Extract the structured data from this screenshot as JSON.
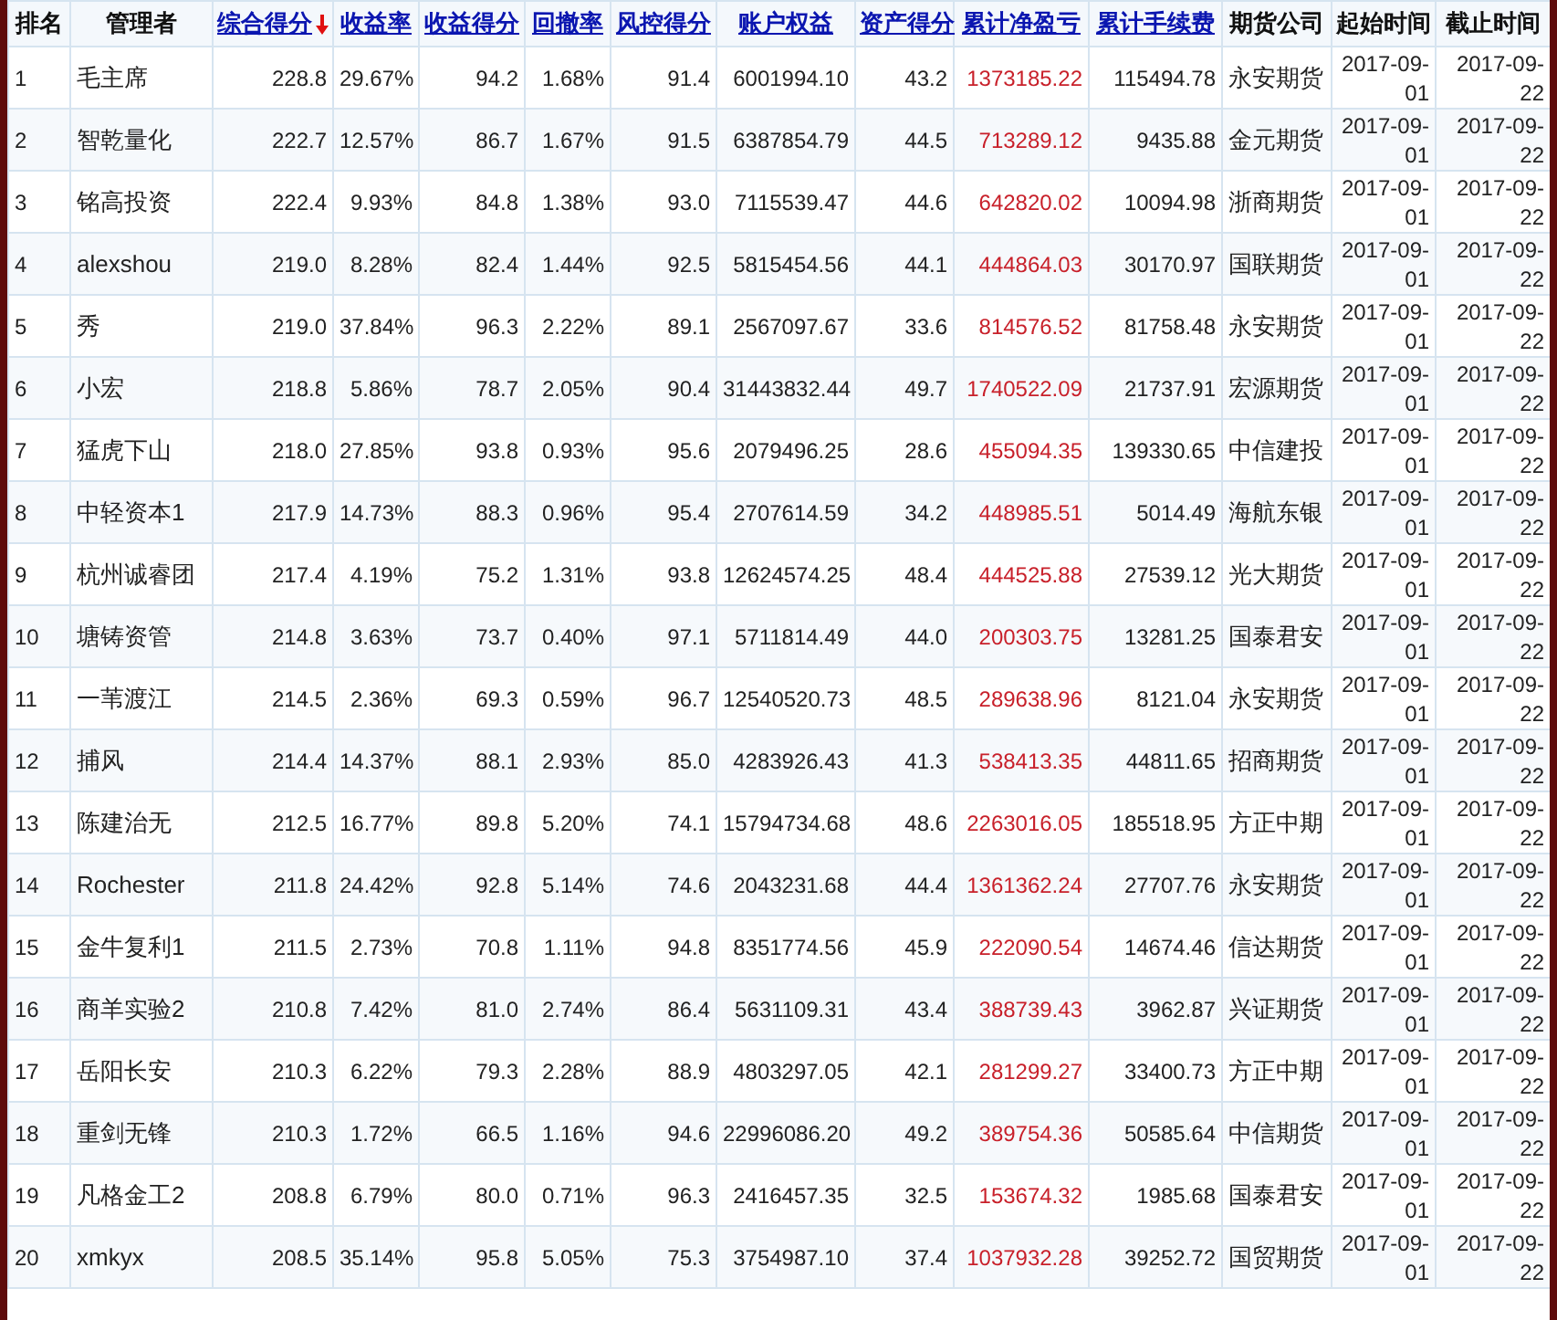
{
  "table": {
    "columns": [
      {
        "label": "排名",
        "link": false,
        "sorted": false
      },
      {
        "label": "管理者",
        "link": false,
        "sorted": false
      },
      {
        "label": "综合得分",
        "link": true,
        "sorted": true
      },
      {
        "label": "收益率",
        "link": true,
        "sorted": false
      },
      {
        "label": "收益得分",
        "link": true,
        "sorted": false
      },
      {
        "label": "回撤率",
        "link": true,
        "sorted": false
      },
      {
        "label": "风控得分",
        "link": true,
        "sorted": false
      },
      {
        "label": "账户权益",
        "link": true,
        "sorted": false
      },
      {
        "label": "资产得分",
        "link": true,
        "sorted": false
      },
      {
        "label": "累计净盈亏",
        "link": true,
        "sorted": false
      },
      {
        "label": "累计手续费",
        "link": true,
        "sorted": false
      },
      {
        "label": "期货公司",
        "link": false,
        "sorted": false
      },
      {
        "label": "起始时间",
        "link": false,
        "sorted": false
      },
      {
        "label": "截止时间",
        "link": false,
        "sorted": false
      }
    ],
    "rows": [
      {
        "rank": "1",
        "manager": "毛主席",
        "composite": "228.8",
        "return_rate": "29.67%",
        "return_score": "94.2",
        "drawdown": "1.68%",
        "risk_score": "91.4",
        "equity": "6001994.10",
        "asset_score": "43.2",
        "net_pnl": "1373185.22",
        "fees": "115494.78",
        "broker": "永安期货",
        "start": "2017-09-01",
        "end": "2017-09-22"
      },
      {
        "rank": "2",
        "manager": "智乾量化",
        "composite": "222.7",
        "return_rate": "12.57%",
        "return_score": "86.7",
        "drawdown": "1.67%",
        "risk_score": "91.5",
        "equity": "6387854.79",
        "asset_score": "44.5",
        "net_pnl": "713289.12",
        "fees": "9435.88",
        "broker": "金元期货",
        "start": "2017-09-01",
        "end": "2017-09-22"
      },
      {
        "rank": "3",
        "manager": "铭高投资",
        "composite": "222.4",
        "return_rate": "9.93%",
        "return_score": "84.8",
        "drawdown": "1.38%",
        "risk_score": "93.0",
        "equity": "7115539.47",
        "asset_score": "44.6",
        "net_pnl": "642820.02",
        "fees": "10094.98",
        "broker": "浙商期货",
        "start": "2017-09-01",
        "end": "2017-09-22"
      },
      {
        "rank": "4",
        "manager": "alexshou",
        "composite": "219.0",
        "return_rate": "8.28%",
        "return_score": "82.4",
        "drawdown": "1.44%",
        "risk_score": "92.5",
        "equity": "5815454.56",
        "asset_score": "44.1",
        "net_pnl": "444864.03",
        "fees": "30170.97",
        "broker": "国联期货",
        "start": "2017-09-01",
        "end": "2017-09-22"
      },
      {
        "rank": "5",
        "manager": "秀",
        "composite": "219.0",
        "return_rate": "37.84%",
        "return_score": "96.3",
        "drawdown": "2.22%",
        "risk_score": "89.1",
        "equity": "2567097.67",
        "asset_score": "33.6",
        "net_pnl": "814576.52",
        "fees": "81758.48",
        "broker": "永安期货",
        "start": "2017-09-01",
        "end": "2017-09-22"
      },
      {
        "rank": "6",
        "manager": "小宏",
        "composite": "218.8",
        "return_rate": "5.86%",
        "return_score": "78.7",
        "drawdown": "2.05%",
        "risk_score": "90.4",
        "equity": "31443832.44",
        "asset_score": "49.7",
        "net_pnl": "1740522.09",
        "fees": "21737.91",
        "broker": "宏源期货",
        "start": "2017-09-01",
        "end": "2017-09-22"
      },
      {
        "rank": "7",
        "manager": "猛虎下山",
        "composite": "218.0",
        "return_rate": "27.85%",
        "return_score": "93.8",
        "drawdown": "0.93%",
        "risk_score": "95.6",
        "equity": "2079496.25",
        "asset_score": "28.6",
        "net_pnl": "455094.35",
        "fees": "139330.65",
        "broker": "中信建投",
        "start": "2017-09-01",
        "end": "2017-09-22"
      },
      {
        "rank": "8",
        "manager": "中轻资本1",
        "composite": "217.9",
        "return_rate": "14.73%",
        "return_score": "88.3",
        "drawdown": "0.96%",
        "risk_score": "95.4",
        "equity": "2707614.59",
        "asset_score": "34.2",
        "net_pnl": "448985.51",
        "fees": "5014.49",
        "broker": "海航东银",
        "start": "2017-09-01",
        "end": "2017-09-22"
      },
      {
        "rank": "9",
        "manager": "杭州诚睿团",
        "composite": "217.4",
        "return_rate": "4.19%",
        "return_score": "75.2",
        "drawdown": "1.31%",
        "risk_score": "93.8",
        "equity": "12624574.25",
        "asset_score": "48.4",
        "net_pnl": "444525.88",
        "fees": "27539.12",
        "broker": "光大期货",
        "start": "2017-09-01",
        "end": "2017-09-22"
      },
      {
        "rank": "10",
        "manager": "塘铸资管",
        "composite": "214.8",
        "return_rate": "3.63%",
        "return_score": "73.7",
        "drawdown": "0.40%",
        "risk_score": "97.1",
        "equity": "5711814.49",
        "asset_score": "44.0",
        "net_pnl": "200303.75",
        "fees": "13281.25",
        "broker": "国泰君安",
        "start": "2017-09-01",
        "end": "2017-09-22"
      },
      {
        "rank": "11",
        "manager": "一苇渡江",
        "composite": "214.5",
        "return_rate": "2.36%",
        "return_score": "69.3",
        "drawdown": "0.59%",
        "risk_score": "96.7",
        "equity": "12540520.73",
        "asset_score": "48.5",
        "net_pnl": "289638.96",
        "fees": "8121.04",
        "broker": "永安期货",
        "start": "2017-09-01",
        "end": "2017-09-22"
      },
      {
        "rank": "12",
        "manager": "捕风",
        "composite": "214.4",
        "return_rate": "14.37%",
        "return_score": "88.1",
        "drawdown": "2.93%",
        "risk_score": "85.0",
        "equity": "4283926.43",
        "asset_score": "41.3",
        "net_pnl": "538413.35",
        "fees": "44811.65",
        "broker": "招商期货",
        "start": "2017-09-01",
        "end": "2017-09-22"
      },
      {
        "rank": "13",
        "manager": "陈建治无",
        "composite": "212.5",
        "return_rate": "16.77%",
        "return_score": "89.8",
        "drawdown": "5.20%",
        "risk_score": "74.1",
        "equity": "15794734.68",
        "asset_score": "48.6",
        "net_pnl": "2263016.05",
        "fees": "185518.95",
        "broker": "方正中期",
        "start": "2017-09-01",
        "end": "2017-09-22"
      },
      {
        "rank": "14",
        "manager": "Rochester",
        "composite": "211.8",
        "return_rate": "24.42%",
        "return_score": "92.8",
        "drawdown": "5.14%",
        "risk_score": "74.6",
        "equity": "2043231.68",
        "asset_score": "44.4",
        "net_pnl": "1361362.24",
        "fees": "27707.76",
        "broker": "永安期货",
        "start": "2017-09-01",
        "end": "2017-09-22"
      },
      {
        "rank": "15",
        "manager": "金牛复利1",
        "composite": "211.5",
        "return_rate": "2.73%",
        "return_score": "70.8",
        "drawdown": "1.11%",
        "risk_score": "94.8",
        "equity": "8351774.56",
        "asset_score": "45.9",
        "net_pnl": "222090.54",
        "fees": "14674.46",
        "broker": "信达期货",
        "start": "2017-09-01",
        "end": "2017-09-22"
      },
      {
        "rank": "16",
        "manager": "商羊实验2",
        "composite": "210.8",
        "return_rate": "7.42%",
        "return_score": "81.0",
        "drawdown": "2.74%",
        "risk_score": "86.4",
        "equity": "5631109.31",
        "asset_score": "43.4",
        "net_pnl": "388739.43",
        "fees": "3962.87",
        "broker": "兴证期货",
        "start": "2017-09-01",
        "end": "2017-09-22"
      },
      {
        "rank": "17",
        "manager": "岳阳长安",
        "composite": "210.3",
        "return_rate": "6.22%",
        "return_score": "79.3",
        "drawdown": "2.28%",
        "risk_score": "88.9",
        "equity": "4803297.05",
        "asset_score": "42.1",
        "net_pnl": "281299.27",
        "fees": "33400.73",
        "broker": "方正中期",
        "start": "2017-09-01",
        "end": "2017-09-22"
      },
      {
        "rank": "18",
        "manager": "重剑无锋",
        "composite": "210.3",
        "return_rate": "1.72%",
        "return_score": "66.5",
        "drawdown": "1.16%",
        "risk_score": "94.6",
        "equity": "22996086.20",
        "asset_score": "49.2",
        "net_pnl": "389754.36",
        "fees": "50585.64",
        "broker": "中信期货",
        "start": "2017-09-01",
        "end": "2017-09-22"
      },
      {
        "rank": "19",
        "manager": "凡格金工2",
        "composite": "208.8",
        "return_rate": "6.79%",
        "return_score": "80.0",
        "drawdown": "0.71%",
        "risk_score": "96.3",
        "equity": "2416457.35",
        "asset_score": "32.5",
        "net_pnl": "153674.32",
        "fees": "1985.68",
        "broker": "国泰君安",
        "start": "2017-09-01",
        "end": "2017-09-22"
      },
      {
        "rank": "20",
        "manager": "xmkyx",
        "composite": "208.5",
        "return_rate": "35.14%",
        "return_score": "95.8",
        "drawdown": "5.05%",
        "risk_score": "75.3",
        "equity": "3754987.10",
        "asset_score": "37.4",
        "net_pnl": "1037932.28",
        "fees": "39252.72",
        "broker": "国贸期货",
        "start": "2017-09-01",
        "end": "2017-09-22"
      }
    ]
  }
}
